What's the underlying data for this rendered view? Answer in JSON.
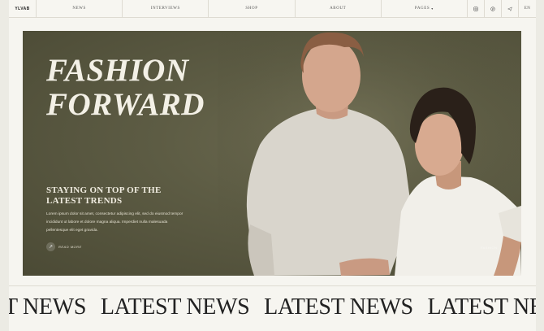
{
  "brand": {
    "logo": "YLVAB"
  },
  "nav": {
    "items": [
      {
        "label": "NEWS"
      },
      {
        "label": "INTERVIEWS"
      },
      {
        "label": "SHOP"
      },
      {
        "label": "ABOUT"
      },
      {
        "label": "PAGES"
      }
    ],
    "pages_caret": "▾",
    "icons": [
      "instagram-icon",
      "pinterest-icon",
      "send-icon"
    ],
    "language": "EN"
  },
  "hero": {
    "title_line1": "FASHION",
    "title_line2": "FORWARD",
    "subtitle_line1": "STAYING ON TOP OF THE",
    "subtitle_line2": "LATEST TRENDS",
    "description": "Lorem ipsum dolor sit amet, consectetur adipiscing elit, sed do eiusmod tempor incididunt ut labore et dolore magna aliqua. Imperdiet nulla malesuada pellentesque elit eget gravida.",
    "read_more": "READ MORE",
    "watermark": "FASHION"
  },
  "ticker": {
    "items": [
      "T NEWS",
      "LATEST NEWS",
      "LATEST NEWS",
      "LATEST NEWS"
    ]
  },
  "colors": {
    "hero_bg": "#5d5c44",
    "page_bg": "#f6f5f0",
    "accent_text": "#f3f0e6"
  }
}
